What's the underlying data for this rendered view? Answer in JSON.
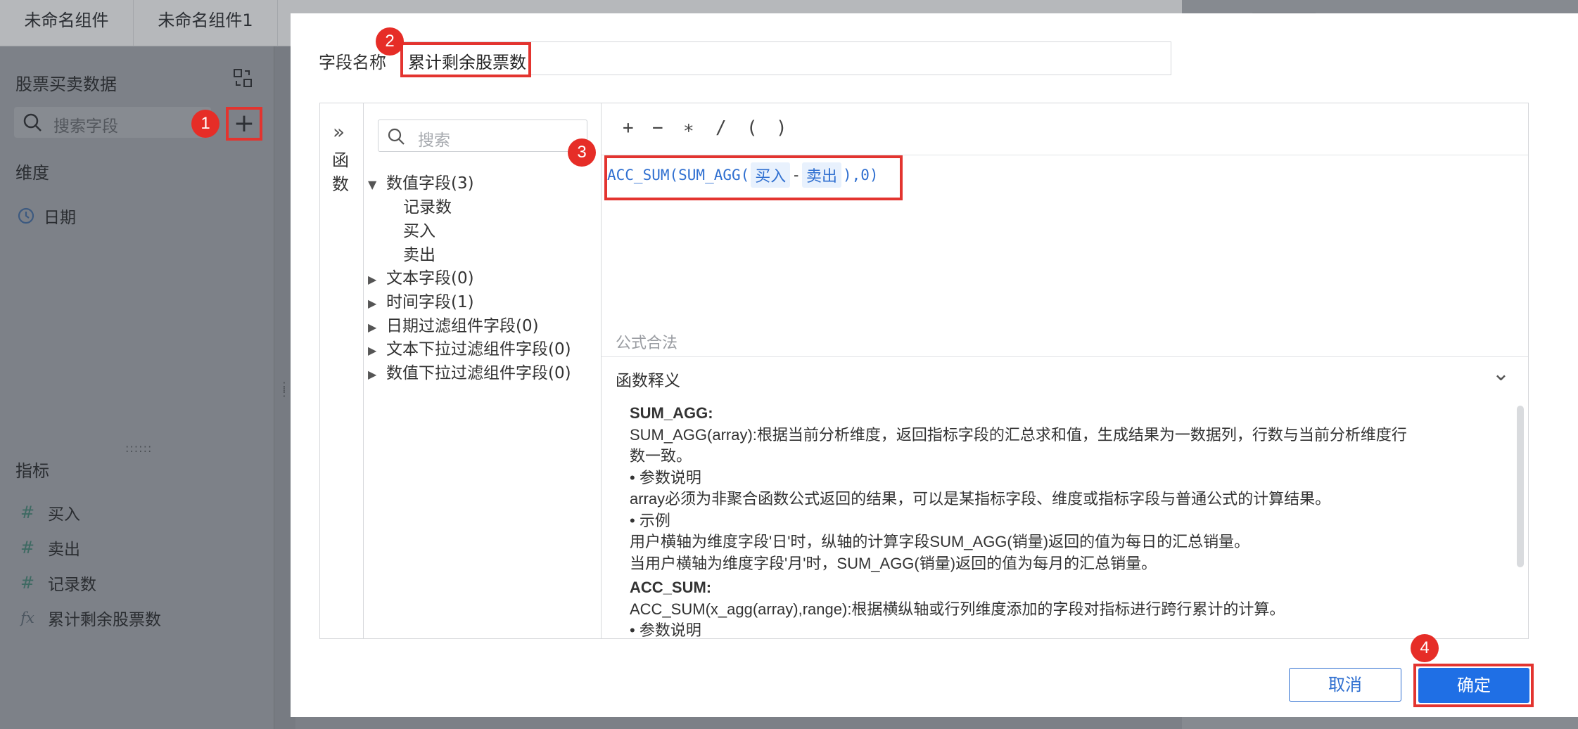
{
  "background": {
    "tabs": [
      "未命名组件",
      "未命名组件1"
    ],
    "sidebar": {
      "dataset_title": "股票买卖数据",
      "search_placeholder": "搜索字段",
      "add_button_label": "+",
      "dimension_label": "维度",
      "dimensions": [
        {
          "name": "日期",
          "icon": "clock-icon"
        }
      ],
      "metric_label": "指标",
      "metrics": [
        {
          "name": "买入",
          "icon": "hash-icon",
          "symbol": "#"
        },
        {
          "name": "卖出",
          "icon": "hash-icon",
          "symbol": "#"
        },
        {
          "name": "记录数",
          "icon": "hash-count-icon",
          "symbol": "#"
        },
        {
          "name": "累计剩余股票数",
          "icon": "formula-icon",
          "symbol": "fx"
        }
      ]
    }
  },
  "badges": [
    "1",
    "2",
    "3",
    "4"
  ],
  "dialog": {
    "field_name_label": "字段名称",
    "field_name_value": "累计剩余股票数",
    "function_panel_label": [
      "函",
      "数"
    ],
    "tree": {
      "search_placeholder": "搜索",
      "groups": [
        {
          "label": "数值字段(3)",
          "expanded": true,
          "children": [
            "记录数",
            "买入",
            "卖出"
          ]
        },
        {
          "label": "文本字段(0)",
          "expanded": false
        },
        {
          "label": "时间字段(1)",
          "expanded": false
        },
        {
          "label": "日期过滤组件字段(0)",
          "expanded": false
        },
        {
          "label": "文本下拉过滤组件字段(0)",
          "expanded": false
        },
        {
          "label": "数值下拉过滤组件字段(0)",
          "expanded": false
        }
      ]
    },
    "operators": [
      "+",
      "−",
      "∗",
      "/",
      "(",
      ")"
    ],
    "formula": {
      "prefix": "ACC_SUM(SUM_AGG(",
      "field_a": "买入",
      "minus": "-",
      "field_b": "卖出",
      "suffix": "),0)"
    },
    "formula_status": "公式合法",
    "explanation_title": "函数释义",
    "explanation": {
      "sum_agg_title": "SUM_AGG:",
      "sum_agg_desc_1": "SUM_AGG(array):根据当前分析维度，返回指标字段的汇总求和值，生成结果为一数据列，行数与当前分析维度行",
      "sum_agg_desc_2": "数一致。",
      "param_title": "• 参数说明",
      "param_desc": "array必须为非聚合函数公式返回的结果，可以是某指标字段、维度或指标字段与普通公式的计算结果。",
      "example_title": "• 示例",
      "example_1": "用户横轴为维度字段'日'时，纵轴的计算字段SUM_AGG(销量)返回的值为每日的汇总销量。",
      "example_2": "当用户横轴为维度字段'月'时，SUM_AGG(销量)返回的值为每月的汇总销量。",
      "acc_sum_title": "ACC_SUM:",
      "acc_sum_desc": "ACC_SUM(x_agg(array),range):根据横纵轴或行列维度添加的字段对指标进行跨行累计的计算。",
      "acc_param_title": "• 参数说明"
    },
    "cancel_label": "取消",
    "ok_label": "确定"
  },
  "colors": {
    "accent": "#1f6fe5",
    "highlight": "#e3342f",
    "badge": "#e62d27"
  }
}
